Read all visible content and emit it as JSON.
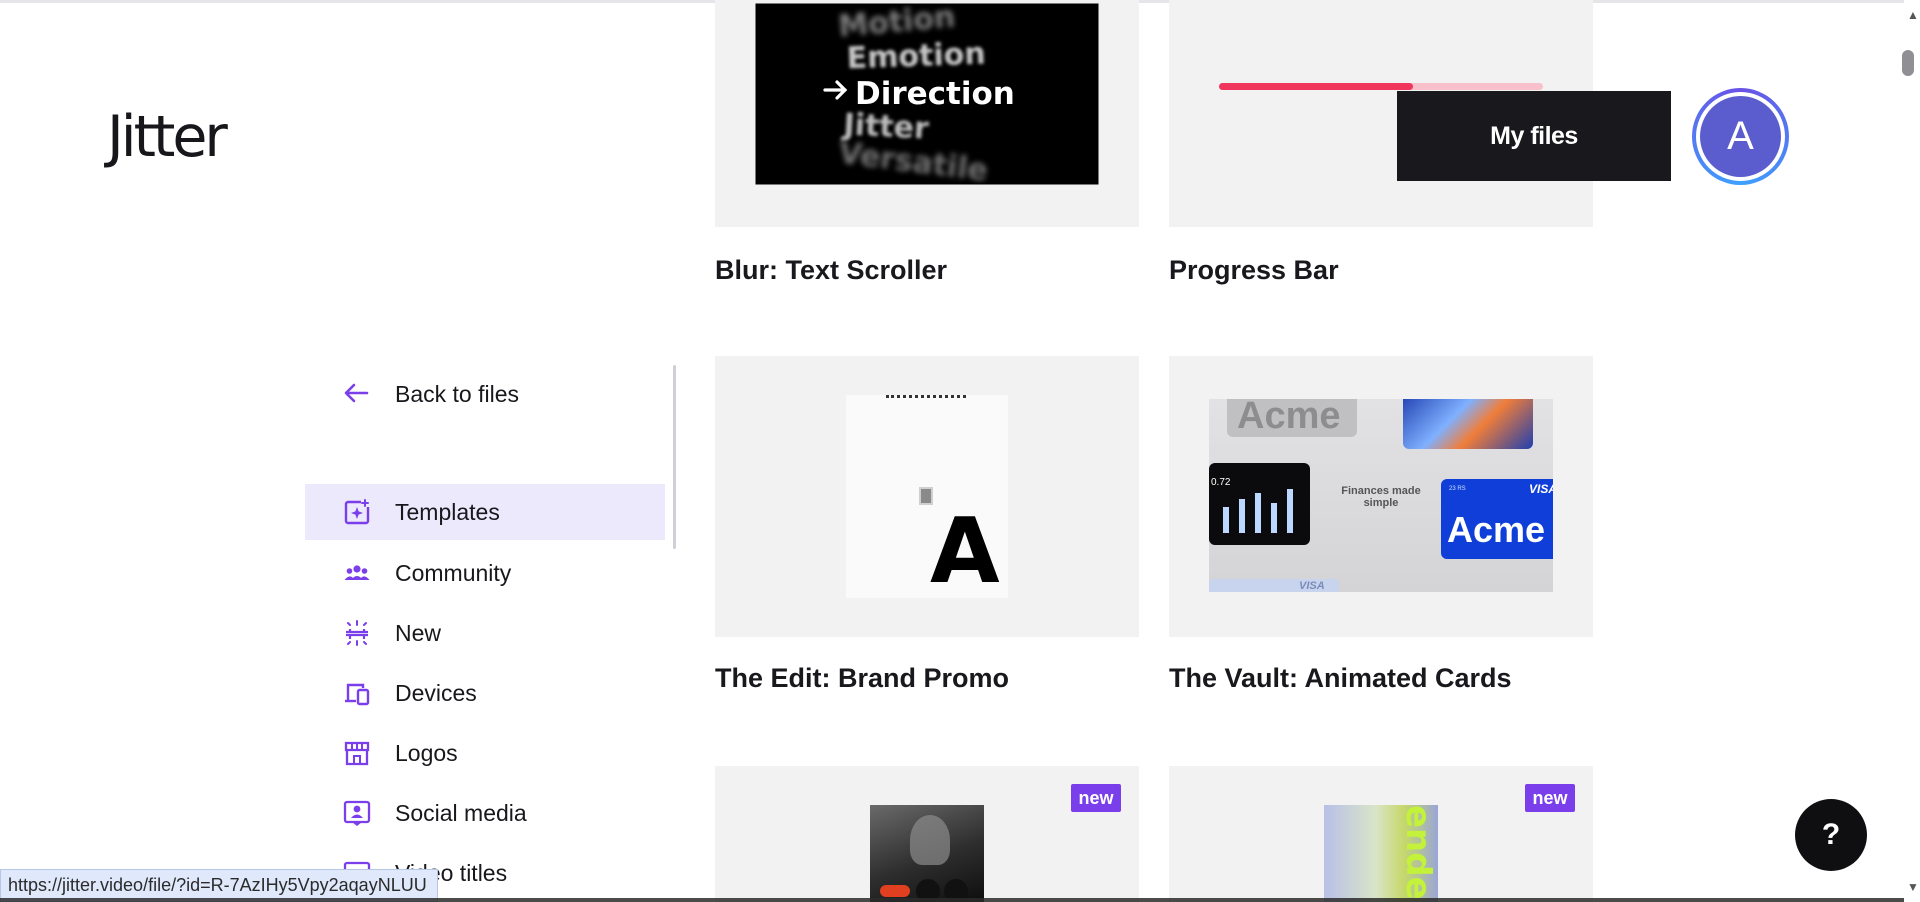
{
  "brand": {
    "logo_text": "Jitter"
  },
  "header": {
    "my_files_label": "My files",
    "avatar_initial": "A"
  },
  "sidebar": {
    "back_label": "Back to files",
    "items": [
      {
        "label": "Templates",
        "icon": "templates-sparkle-icon",
        "active": true
      },
      {
        "label": "Community",
        "icon": "community-people-icon",
        "active": false
      },
      {
        "label": "New",
        "icon": "new-sparkle-icon",
        "active": false
      },
      {
        "label": "Devices",
        "icon": "devices-icon",
        "active": false
      },
      {
        "label": "Logos",
        "icon": "storefront-icon",
        "active": false
      },
      {
        "label": "Social media",
        "icon": "social-profile-icon",
        "active": false
      },
      {
        "label": "Video titles",
        "icon": "video-title-icon",
        "active": false
      }
    ]
  },
  "templates": [
    {
      "title": "Blur: Text Scroller",
      "preview_words": [
        "Motion",
        "Emotion",
        "Direction",
        "Jitter",
        "Versatile"
      ]
    },
    {
      "title": "Progress Bar",
      "progress_fill": 0.6
    },
    {
      "title": "The Edit: Brand Promo",
      "preview_letter": "A"
    },
    {
      "title": "The Vault: Animated Cards",
      "preview_texts": {
        "card_brand": "Acme",
        "tagline": "Finances made simple",
        "network": "VISA",
        "balance": "0.72",
        "small_amount": "23 RS"
      }
    },
    {
      "title": "",
      "badge": "new"
    },
    {
      "title": "",
      "badge": "new",
      "preview_text": "ender"
    }
  ],
  "help": {
    "label": "?"
  },
  "status_bar": {
    "url": "https://jitter.video/file/?id=R-7AzIHy5Vpy2aqayNLUU"
  },
  "colors": {
    "accent": "#7a3fea",
    "active_bg": "#ede9fd",
    "progress_fill": "#f0365d",
    "progress_track": "#f7c0cb",
    "card_bg": "#f2f2f3"
  }
}
